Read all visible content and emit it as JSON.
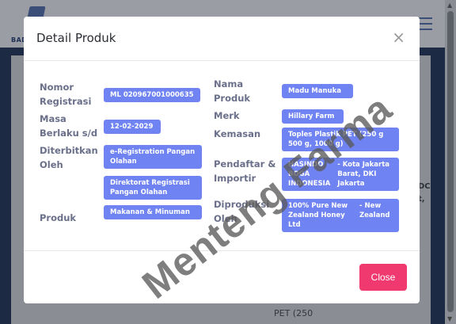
{
  "background": {
    "logo_text": "BAD",
    "side_text_1": "DC",
    "side_text_2": "t,",
    "bottom_text": "PET (250"
  },
  "modal": {
    "title": "Detail Produk",
    "close_icon": "×",
    "close_button": "Close",
    "left": {
      "nomor_label": "Nomor Registrasi",
      "nomor_value": "ML 020967001000635",
      "masa_label": "Masa Berlaku s/d",
      "masa_value": "12-02-2029",
      "diterbitkan_label": "Diterbitkan Oleh",
      "diterbitkan_value_1": "e-Registration Pangan Olahan",
      "diterbitkan_value_2": "Direktorat Registrasi Pangan Olahan",
      "produk_label": "Produk",
      "produk_value": "Makanan & Minuman"
    },
    "right": {
      "nama_label": "Nama Produk",
      "nama_value": "Madu Manuka",
      "merk_label": "Merk",
      "merk_value": "Hillary Farm",
      "kemasan_label": "Kemasan",
      "kemasan_value": "Toples Plastik PET (250 g 500 g, 1000 g)",
      "pendaftar_label": "Pendaftar & Importir",
      "pendaftar_value_a": "HASINDO BOGA INDONESIA",
      "pendaftar_value_b": "- Kota Jakarta Barat, DKI Jakarta",
      "diproduksi_label": "Diproduksi Oleh",
      "diproduksi_value_a": "100% Pure New Zealand Honey Ltd",
      "diproduksi_value_b": "- New Zealand"
    }
  },
  "watermark": "Menteng Farma"
}
